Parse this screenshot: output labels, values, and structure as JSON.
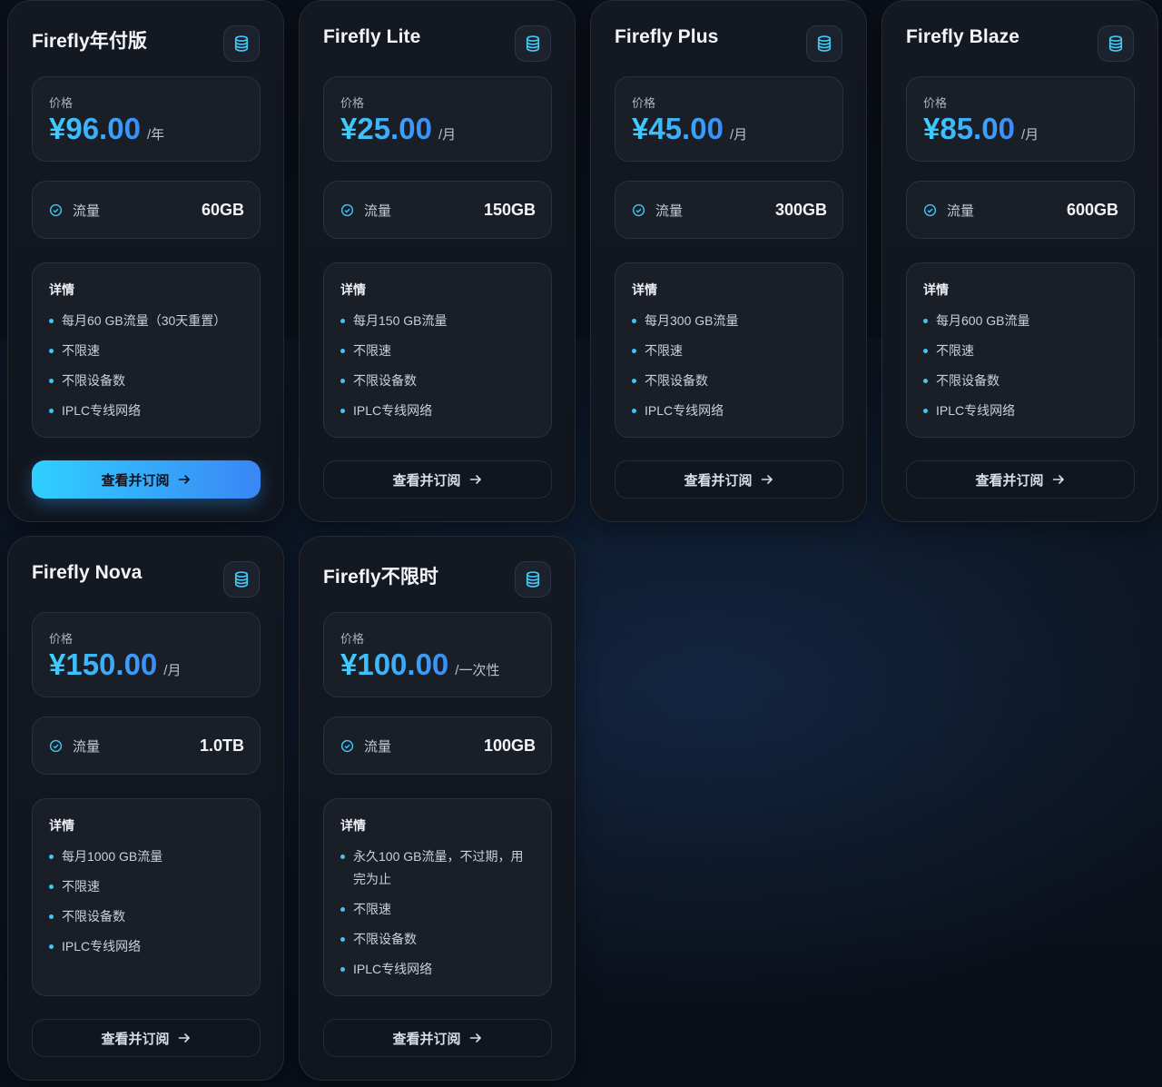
{
  "plans": [
    {
      "title": "Firefly年付版",
      "price_label": "价格",
      "price": "¥96.00",
      "unit": "/年",
      "traffic_label": "流量",
      "traffic": "60GB",
      "details_title": "详情",
      "details": [
        "每月60 GB流量（30天重置）",
        "不限速",
        "不限设备数",
        "IPLC专线网络"
      ],
      "button_label": "查看并订阅",
      "highlighted": true
    },
    {
      "title": "Firefly Lite",
      "price_label": "价格",
      "price": "¥25.00",
      "unit": "/月",
      "traffic_label": "流量",
      "traffic": "150GB",
      "details_title": "详情",
      "details": [
        "每月150 GB流量",
        "不限速",
        "不限设备数",
        "IPLC专线网络"
      ],
      "button_label": "查看并订阅",
      "highlighted": false
    },
    {
      "title": "Firefly Plus",
      "price_label": "价格",
      "price": "¥45.00",
      "unit": "/月",
      "traffic_label": "流量",
      "traffic": "300GB",
      "details_title": "详情",
      "details": [
        "每月300 GB流量",
        "不限速",
        "不限设备数",
        "IPLC专线网络"
      ],
      "button_label": "查看并订阅",
      "highlighted": false
    },
    {
      "title": "Firefly Blaze",
      "price_label": "价格",
      "price": "¥85.00",
      "unit": "/月",
      "traffic_label": "流量",
      "traffic": "600GB",
      "details_title": "详情",
      "details": [
        "每月600 GB流量",
        "不限速",
        "不限设备数",
        "IPLC专线网络"
      ],
      "button_label": "查看并订阅",
      "highlighted": false
    },
    {
      "title": "Firefly Nova",
      "price_label": "价格",
      "price": "¥150.00",
      "unit": "/月",
      "traffic_label": "流量",
      "traffic": "1.0TB",
      "details_title": "详情",
      "details": [
        "每月1000 GB流量",
        "不限速",
        "不限设备数",
        "IPLC专线网络"
      ],
      "button_label": "查看并订阅",
      "highlighted": false
    },
    {
      "title": "Firefly不限时",
      "price_label": "价格",
      "price": "¥100.00",
      "unit": "/一次性",
      "traffic_label": "流量",
      "traffic": "100GB",
      "details_title": "详情",
      "details": [
        "永久100 GB流量，不过期，用完为止",
        "不限速",
        "不限设备数",
        "IPLC专线网络"
      ],
      "button_label": "查看并订阅",
      "highlighted": false
    }
  ],
  "icons": {
    "plan_badge": "database-icon",
    "traffic": "check-circle-icon",
    "button": "arrow-right-icon"
  },
  "colors": {
    "accent_start": "#3ed0ff",
    "accent_end": "#3a8cf6",
    "bullet": "#3fc6f5"
  }
}
